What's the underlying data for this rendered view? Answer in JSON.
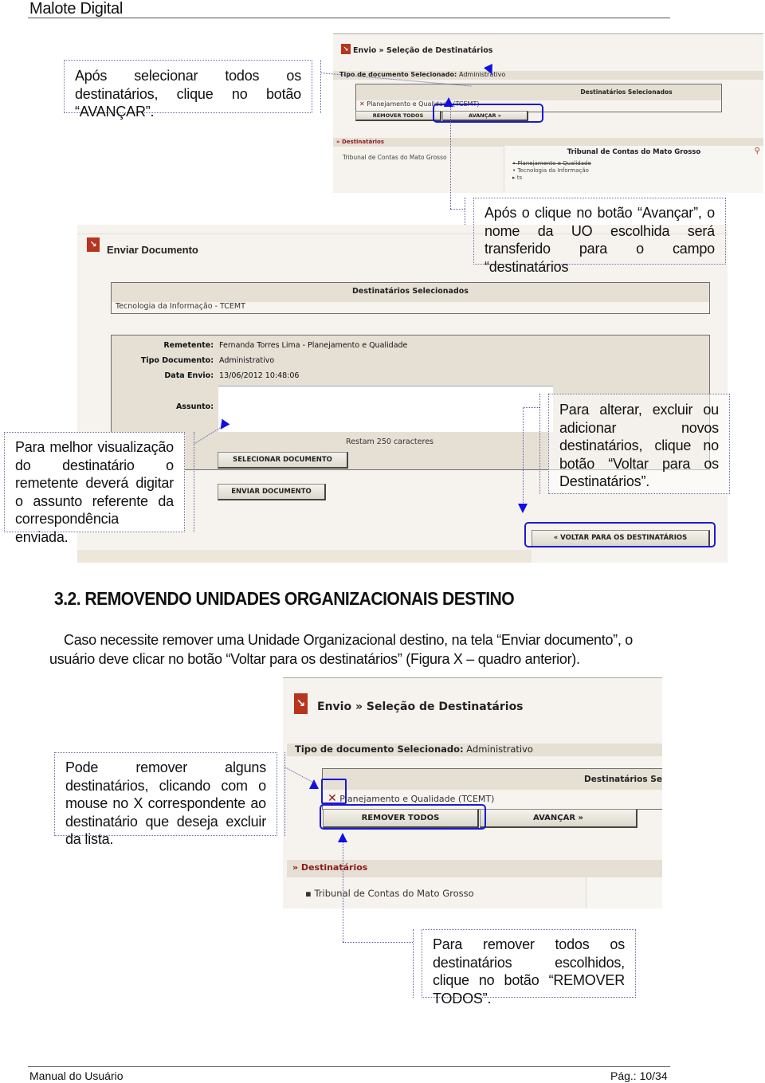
{
  "document": {
    "title": "Malote Digital",
    "footer_left": "Manual do Usuário",
    "footer_right": "Pág.: 10/34"
  },
  "callouts": {
    "avancar": "Após selecionar todos os destinatários, clique no botão “AVANÇAR”.",
    "transferido": "Após o clique no botão “Avançar”, o nome da UO escolhida será transferido para o campo “destinatários",
    "assunto": "Para melhor visualização do destinatário o remetente deverá digitar o assunto referente da correspondência enviada.",
    "voltar": "Para alterar, excluir ou adicionar novos destinatários, clique no botão “Voltar para os Destinatários”.",
    "remover_x": "Pode remover alguns destinatários, clicando com o mouse no X correspondente ao destinatário que deseja excluir da lista.",
    "remover_todos": "Para remover todos os destinatários escolhidos, clique no botão “REMOVER TODOS”."
  },
  "screen1": {
    "title": "Envio » Seleção de Destinatários",
    "tipo_label": "Tipo de documento Selecionado:",
    "tipo_value": "Administrativo",
    "selected_header": "Destinatários Selecionados",
    "selected_items": [
      "Planejamento e Qualidade (TCEMT)"
    ],
    "remove_all_button": "REMOVER TODOS",
    "advance_button": "AVANÇAR »",
    "destinatarios_header": "» Destinatários",
    "tree_root": "Tribunal de Contas do Mato Grosso",
    "org_title": "Tribunal de Contas do Mato Grosso",
    "org_items": [
      {
        "label": "Planejamento e Qualidade",
        "struck": true
      },
      {
        "label": "Tecnologia da Informação",
        "struck": false
      },
      {
        "label": "ts",
        "struck": false
      }
    ]
  },
  "screen2": {
    "title": "Enviar Documento",
    "selected_header": "Destinatários Selecionados",
    "selected_item": "Tecnologia da Informação - TCEMT",
    "fields": [
      {
        "label": "Remetente:",
        "value": "Fernanda Torres Lima - Planejamento e Qualidade"
      },
      {
        "label": "Tipo Documento:",
        "value": "Administrativo"
      },
      {
        "label": "Data Envio:",
        "value": "13/06/2012 10:48:06"
      }
    ],
    "assunto_label": "Assunto:",
    "assunto_value": "",
    "char_counter": "Restam 250 caracteres",
    "select_doc_button": "SELECIONAR DOCUMENTO",
    "send_doc_button": "ENVIAR DOCUMENTO",
    "back_button": "« VOLTAR PARA OS DESTINATÁRIOS"
  },
  "section": {
    "title": "3.2. REMOVENDO UNIDADES ORGANIZACIONAIS DESTINO",
    "body": "Caso necessite remover uma Unidade Organizacional destino, na tela “Enviar documento”, o usuário deve clicar no botão “Voltar para os destinatários” (Figura X – quadro anterior)."
  },
  "screen3": {
    "title": "Envio » Seleção de Destinatários",
    "tipo_label": "Tipo de documento Selecionado:",
    "tipo_value": "Administrativo",
    "selected_header": "Destinatários Selecionados",
    "selected_items": [
      "Planejamento e Qualidade (TCEMT)"
    ],
    "remove_all_button": "REMOVER TODOS",
    "advance_button": "AVANÇAR »",
    "destinatarios_header": "» Destinatários",
    "tree_root": "Tribunal de Contas do Mato Grosso"
  }
}
